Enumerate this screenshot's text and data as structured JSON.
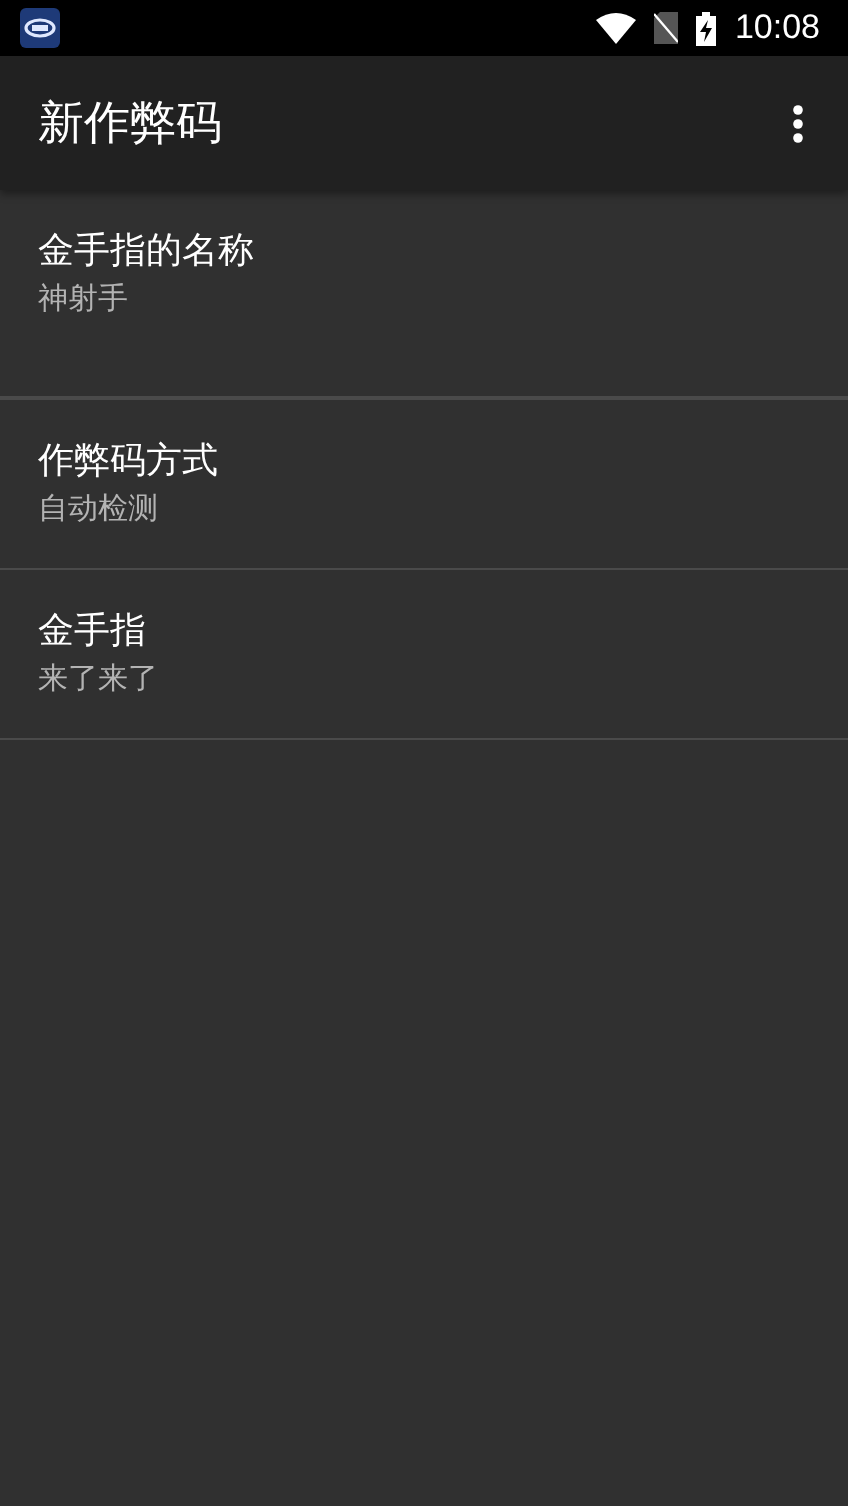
{
  "status_bar": {
    "time": "10:08"
  },
  "app_bar": {
    "title": "新作弊码"
  },
  "preferences": [
    {
      "title": "金手指的名称",
      "summary": "神射手"
    },
    {
      "title": "作弊码方式",
      "summary": "自动检测"
    },
    {
      "title": "金手指",
      "summary": "来了来了"
    }
  ]
}
